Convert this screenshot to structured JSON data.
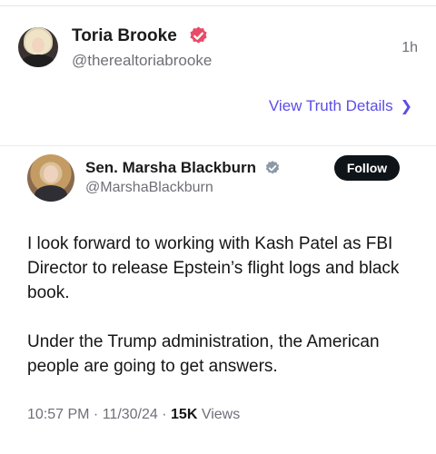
{
  "truth": {
    "author_name": "Toria Brooke",
    "author_handle": "@therealtoriabrooke",
    "time_ago": "1h",
    "view_details_label": "View Truth Details",
    "verified_badge_color": "#e94b66"
  },
  "quoted_tweet": {
    "author_name": "Sen. Marsha Blackburn",
    "author_handle": "@MarshaBlackburn",
    "follow_label": "Follow",
    "verified_badge_color": "#8b98a5",
    "paragraphs": [
      "I look forward to working with Kash Patel as FBI Director to release Epstein’s flight logs and black book.",
      "Under the Trump administration, the American people are going to get answers."
    ],
    "time": "10:57 PM",
    "date": "11/30/24",
    "views_count": "15K",
    "views_label": "Views"
  }
}
